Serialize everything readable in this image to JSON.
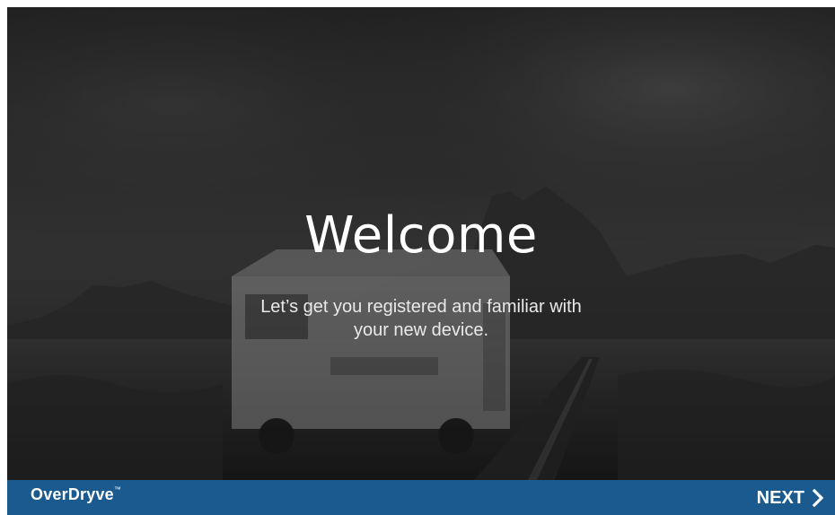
{
  "hero": {
    "title": "Welcome",
    "subtitle_line1": "Let’s get you registered and familiar with",
    "subtitle_line2": "your new device."
  },
  "footer": {
    "brand": "OverDryve",
    "next_label": "NEXT",
    "next_icon": "chevron-right-icon",
    "background": "#1b5a8e"
  },
  "colors": {
    "text": "#ffffff",
    "footer_bg": "#1b5a8e"
  }
}
